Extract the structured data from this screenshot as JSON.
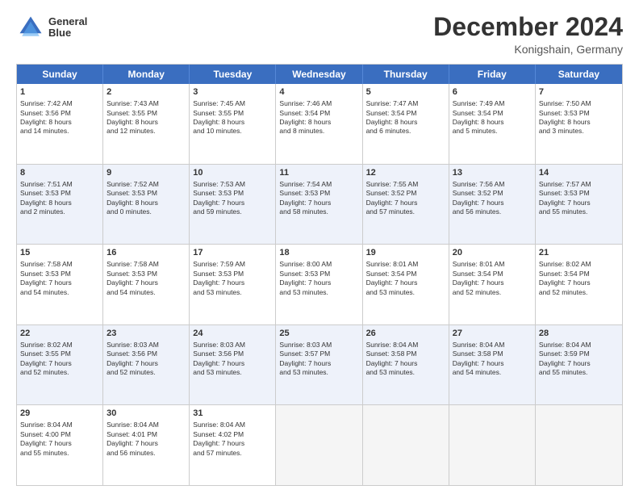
{
  "header": {
    "logo_line1": "General",
    "logo_line2": "Blue",
    "month": "December 2024",
    "location": "Konigshain, Germany"
  },
  "weekdays": [
    "Sunday",
    "Monday",
    "Tuesday",
    "Wednesday",
    "Thursday",
    "Friday",
    "Saturday"
  ],
  "rows": [
    [
      {
        "day": "1",
        "lines": [
          "Sunrise: 7:42 AM",
          "Sunset: 3:56 PM",
          "Daylight: 8 hours",
          "and 14 minutes."
        ]
      },
      {
        "day": "2",
        "lines": [
          "Sunrise: 7:43 AM",
          "Sunset: 3:55 PM",
          "Daylight: 8 hours",
          "and 12 minutes."
        ]
      },
      {
        "day": "3",
        "lines": [
          "Sunrise: 7:45 AM",
          "Sunset: 3:55 PM",
          "Daylight: 8 hours",
          "and 10 minutes."
        ]
      },
      {
        "day": "4",
        "lines": [
          "Sunrise: 7:46 AM",
          "Sunset: 3:54 PM",
          "Daylight: 8 hours",
          "and 8 minutes."
        ]
      },
      {
        "day": "5",
        "lines": [
          "Sunrise: 7:47 AM",
          "Sunset: 3:54 PM",
          "Daylight: 8 hours",
          "and 6 minutes."
        ]
      },
      {
        "day": "6",
        "lines": [
          "Sunrise: 7:49 AM",
          "Sunset: 3:54 PM",
          "Daylight: 8 hours",
          "and 5 minutes."
        ]
      },
      {
        "day": "7",
        "lines": [
          "Sunrise: 7:50 AM",
          "Sunset: 3:53 PM",
          "Daylight: 8 hours",
          "and 3 minutes."
        ]
      }
    ],
    [
      {
        "day": "8",
        "lines": [
          "Sunrise: 7:51 AM",
          "Sunset: 3:53 PM",
          "Daylight: 8 hours",
          "and 2 minutes."
        ]
      },
      {
        "day": "9",
        "lines": [
          "Sunrise: 7:52 AM",
          "Sunset: 3:53 PM",
          "Daylight: 8 hours",
          "and 0 minutes."
        ]
      },
      {
        "day": "10",
        "lines": [
          "Sunrise: 7:53 AM",
          "Sunset: 3:53 PM",
          "Daylight: 7 hours",
          "and 59 minutes."
        ]
      },
      {
        "day": "11",
        "lines": [
          "Sunrise: 7:54 AM",
          "Sunset: 3:53 PM",
          "Daylight: 7 hours",
          "and 58 minutes."
        ]
      },
      {
        "day": "12",
        "lines": [
          "Sunrise: 7:55 AM",
          "Sunset: 3:52 PM",
          "Daylight: 7 hours",
          "and 57 minutes."
        ]
      },
      {
        "day": "13",
        "lines": [
          "Sunrise: 7:56 AM",
          "Sunset: 3:52 PM",
          "Daylight: 7 hours",
          "and 56 minutes."
        ]
      },
      {
        "day": "14",
        "lines": [
          "Sunrise: 7:57 AM",
          "Sunset: 3:53 PM",
          "Daylight: 7 hours",
          "and 55 minutes."
        ]
      }
    ],
    [
      {
        "day": "15",
        "lines": [
          "Sunrise: 7:58 AM",
          "Sunset: 3:53 PM",
          "Daylight: 7 hours",
          "and 54 minutes."
        ]
      },
      {
        "day": "16",
        "lines": [
          "Sunrise: 7:58 AM",
          "Sunset: 3:53 PM",
          "Daylight: 7 hours",
          "and 54 minutes."
        ]
      },
      {
        "day": "17",
        "lines": [
          "Sunrise: 7:59 AM",
          "Sunset: 3:53 PM",
          "Daylight: 7 hours",
          "and 53 minutes."
        ]
      },
      {
        "day": "18",
        "lines": [
          "Sunrise: 8:00 AM",
          "Sunset: 3:53 PM",
          "Daylight: 7 hours",
          "and 53 minutes."
        ]
      },
      {
        "day": "19",
        "lines": [
          "Sunrise: 8:01 AM",
          "Sunset: 3:54 PM",
          "Daylight: 7 hours",
          "and 53 minutes."
        ]
      },
      {
        "day": "20",
        "lines": [
          "Sunrise: 8:01 AM",
          "Sunset: 3:54 PM",
          "Daylight: 7 hours",
          "and 52 minutes."
        ]
      },
      {
        "day": "21",
        "lines": [
          "Sunrise: 8:02 AM",
          "Sunset: 3:54 PM",
          "Daylight: 7 hours",
          "and 52 minutes."
        ]
      }
    ],
    [
      {
        "day": "22",
        "lines": [
          "Sunrise: 8:02 AM",
          "Sunset: 3:55 PM",
          "Daylight: 7 hours",
          "and 52 minutes."
        ]
      },
      {
        "day": "23",
        "lines": [
          "Sunrise: 8:03 AM",
          "Sunset: 3:56 PM",
          "Daylight: 7 hours",
          "and 52 minutes."
        ]
      },
      {
        "day": "24",
        "lines": [
          "Sunrise: 8:03 AM",
          "Sunset: 3:56 PM",
          "Daylight: 7 hours",
          "and 53 minutes."
        ]
      },
      {
        "day": "25",
        "lines": [
          "Sunrise: 8:03 AM",
          "Sunset: 3:57 PM",
          "Daylight: 7 hours",
          "and 53 minutes."
        ]
      },
      {
        "day": "26",
        "lines": [
          "Sunrise: 8:04 AM",
          "Sunset: 3:58 PM",
          "Daylight: 7 hours",
          "and 53 minutes."
        ]
      },
      {
        "day": "27",
        "lines": [
          "Sunrise: 8:04 AM",
          "Sunset: 3:58 PM",
          "Daylight: 7 hours",
          "and 54 minutes."
        ]
      },
      {
        "day": "28",
        "lines": [
          "Sunrise: 8:04 AM",
          "Sunset: 3:59 PM",
          "Daylight: 7 hours",
          "and 55 minutes."
        ]
      }
    ],
    [
      {
        "day": "29",
        "lines": [
          "Sunrise: 8:04 AM",
          "Sunset: 4:00 PM",
          "Daylight: 7 hours",
          "and 55 minutes."
        ]
      },
      {
        "day": "30",
        "lines": [
          "Sunrise: 8:04 AM",
          "Sunset: 4:01 PM",
          "Daylight: 7 hours",
          "and 56 minutes."
        ]
      },
      {
        "day": "31",
        "lines": [
          "Sunrise: 8:04 AM",
          "Sunset: 4:02 PM",
          "Daylight: 7 hours",
          "and 57 minutes."
        ]
      },
      null,
      null,
      null,
      null
    ]
  ]
}
